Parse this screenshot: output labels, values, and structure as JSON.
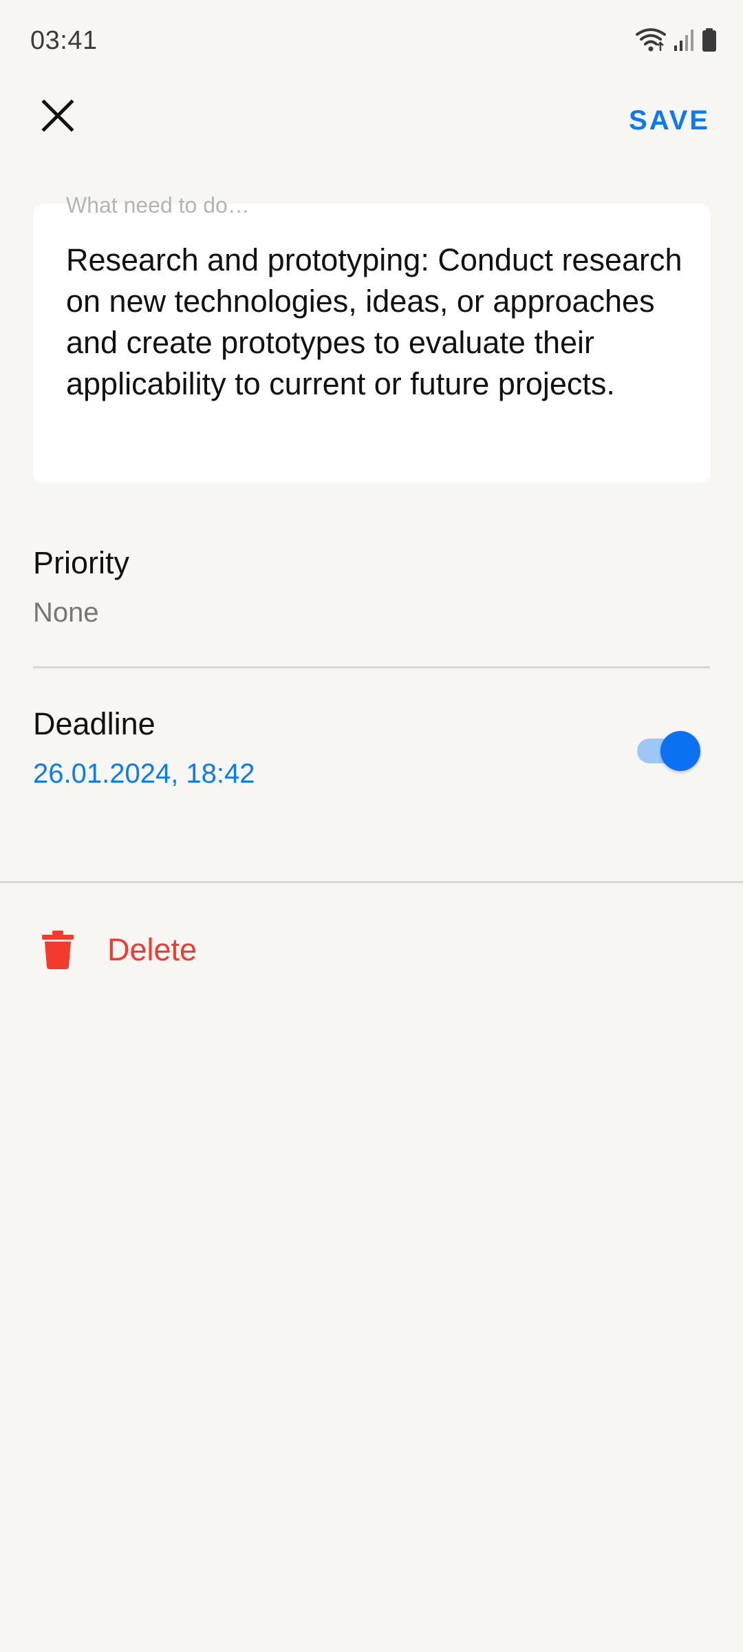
{
  "status_bar": {
    "time": "03:41",
    "icons": [
      "wifi-icon",
      "signal-icon",
      "battery-icon"
    ]
  },
  "toolbar": {
    "close_icon": "close-icon",
    "save_label": "SAVE"
  },
  "task": {
    "placeholder": "What need to do…",
    "text": "Research and prototyping: Conduct research on new technologies, ideas, or approaches and create prototypes to evaluate their applicability to current or future projects."
  },
  "priority": {
    "label": "Priority",
    "value": "None"
  },
  "deadline": {
    "label": "Deadline",
    "value": "26.01.2024, 18:42",
    "enabled": true
  },
  "delete": {
    "label": "Delete",
    "icon": "trash-icon"
  },
  "colors": {
    "background": "#F7F6F2",
    "accent": "#0A7BF5",
    "danger": "#F23A2F",
    "card": "#FFFFFF",
    "secondary_text": "#767676"
  }
}
